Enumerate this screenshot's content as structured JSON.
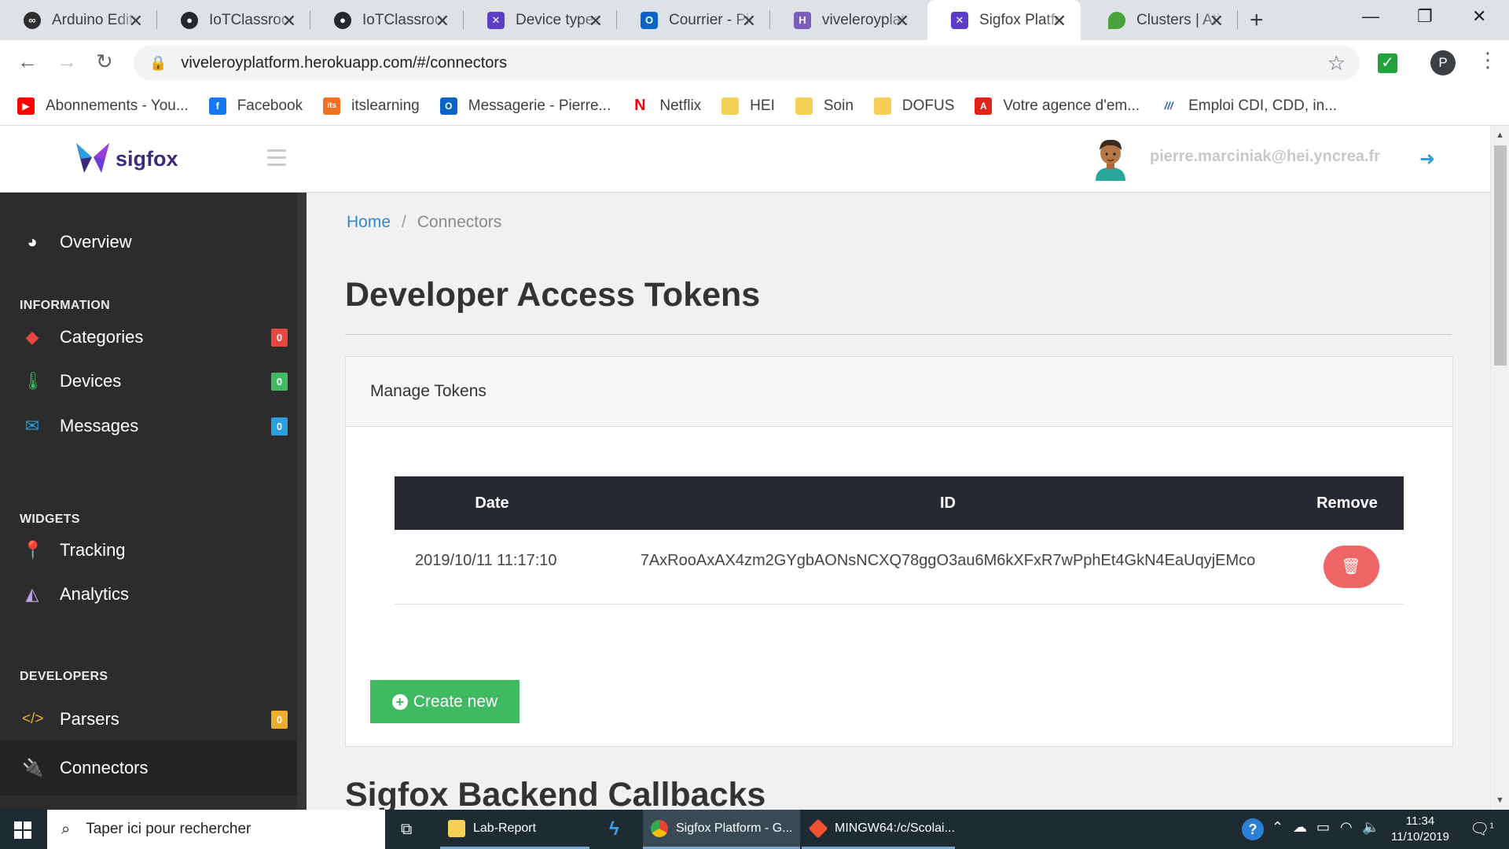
{
  "browser": {
    "tabs": [
      {
        "title": "Arduino Editor",
        "icon": "arduino-icon",
        "color": "#2d2d2d"
      },
      {
        "title": "IoTClassroom",
        "icon": "github-icon",
        "color": "#24292e"
      },
      {
        "title": "IoTClassroom",
        "icon": "github-icon",
        "color": "#24292e"
      },
      {
        "title": "Device types",
        "icon": "sigfox-icon",
        "color": "#5c3ec6"
      },
      {
        "title": "Courrier - Pierre",
        "icon": "outlook-icon",
        "color": "#0a64c6"
      },
      {
        "title": "viveleroyplatform",
        "icon": "heroku-icon",
        "color": "#7b5dbb"
      },
      {
        "title": "Sigfox Platform",
        "icon": "sigfox-icon",
        "color": "#5c3ec6"
      },
      {
        "title": "Clusters | Atlas",
        "icon": "mongodb-leaf-icon",
        "color": "#4aa23d"
      }
    ],
    "url": "viveleroyplatform.herokuapp.com/#/connectors",
    "extension_badge": "✓",
    "profile_initial": "P"
  },
  "bookmarks": [
    {
      "label": "Abonnements - You...",
      "icon": "youtube-icon",
      "color": "#ff0000",
      "glyph": "▶"
    },
    {
      "label": "Facebook",
      "icon": "facebook-icon",
      "color": "#1877f2",
      "glyph": "f"
    },
    {
      "label": "itslearning",
      "icon": "itslearning-icon",
      "color": "#f36f21",
      "glyph": "its"
    },
    {
      "label": "Messagerie - Pierre...",
      "icon": "outlook-icon",
      "color": "#0a64c6",
      "glyph": "O"
    },
    {
      "label": "Netflix",
      "icon": "netflix-icon",
      "color": "#e50914",
      "glyph": "N"
    },
    {
      "label": "HEI",
      "icon": "folder-icon",
      "color": "#f6cf57",
      "glyph": ""
    },
    {
      "label": "Soin",
      "icon": "folder-icon",
      "color": "#f6cf57",
      "glyph": ""
    },
    {
      "label": "DOFUS",
      "icon": "folder-icon",
      "color": "#f6cf57",
      "glyph": ""
    },
    {
      "label": "Votre agence d'em...",
      "icon": "pole-emploi-icon",
      "color": "#e2231a",
      "glyph": "A"
    },
    {
      "label": "Emploi CDI, CDD, in...",
      "icon": "indeed-icon",
      "color": "#2557a7",
      "glyph": "///"
    }
  ],
  "header": {
    "brand": "sigfox",
    "user_email": "pierre.marciniak@hei.yncrea.fr"
  },
  "sidebar": {
    "overview": "Overview",
    "sections": {
      "information": "INFORMATION",
      "widgets": "WIDGETS",
      "developers": "DEVELOPERS"
    },
    "items": [
      {
        "label": "Categories",
        "badge": "0",
        "badge_color": "#e8473f",
        "icon": "tag-icon",
        "icon_color": "#e8473f"
      },
      {
        "label": "Devices",
        "badge": "0",
        "badge_color": "#3fba63",
        "icon": "thermometer-icon",
        "icon_color": "#3fba63"
      },
      {
        "label": "Messages",
        "badge": "0",
        "badge_color": "#2b9fe0",
        "icon": "envelope-icon",
        "icon_color": "#2b9fe0"
      },
      {
        "label": "Tracking",
        "icon": "map-marker-icon",
        "icon_color": "#e8473f"
      },
      {
        "label": "Analytics",
        "icon": "area-chart-icon",
        "icon_color": "#b9a4e6"
      },
      {
        "label": "Parsers",
        "badge": "0",
        "badge_color": "#f0ad2e",
        "icon": "code-icon",
        "icon_color": "#f0ad2e"
      },
      {
        "label": "Connectors",
        "icon": "plug-icon",
        "icon_color": "#2b9fe0"
      }
    ]
  },
  "main": {
    "breadcrumb": {
      "home": "Home",
      "separator": "/",
      "current": "Connectors"
    },
    "title": "Developer Access Tokens",
    "card_title": "Manage Tokens",
    "table": {
      "headers": [
        "Date",
        "ID",
        "Remove"
      ],
      "rows": [
        {
          "date": "2019/10/11 11:17:10",
          "id": "7AxRooAxAX4zm2GYgbAONsNCXQ78ggO3au6M6kXFxR7wPphEt4GkN4EaUqyjEMco"
        }
      ]
    },
    "create_button": "Create new",
    "next_section_title": "Sigfox Backend Callbacks"
  },
  "taskbar": {
    "search_placeholder": "Taper ici pour rechercher",
    "apps": [
      {
        "label": "",
        "icon": "task-view-icon"
      },
      {
        "label": "Lab-Report",
        "icon": "folder-icon"
      },
      {
        "label": "",
        "icon": "visual-studio-icon"
      },
      {
        "label": "Sigfox Platform - G...",
        "icon": "chrome-icon"
      },
      {
        "label": "MINGW64:/c/Scolai...",
        "icon": "git-bash-icon"
      }
    ],
    "time": "11:34",
    "date": "11/10/2019",
    "notification_count": "1"
  }
}
